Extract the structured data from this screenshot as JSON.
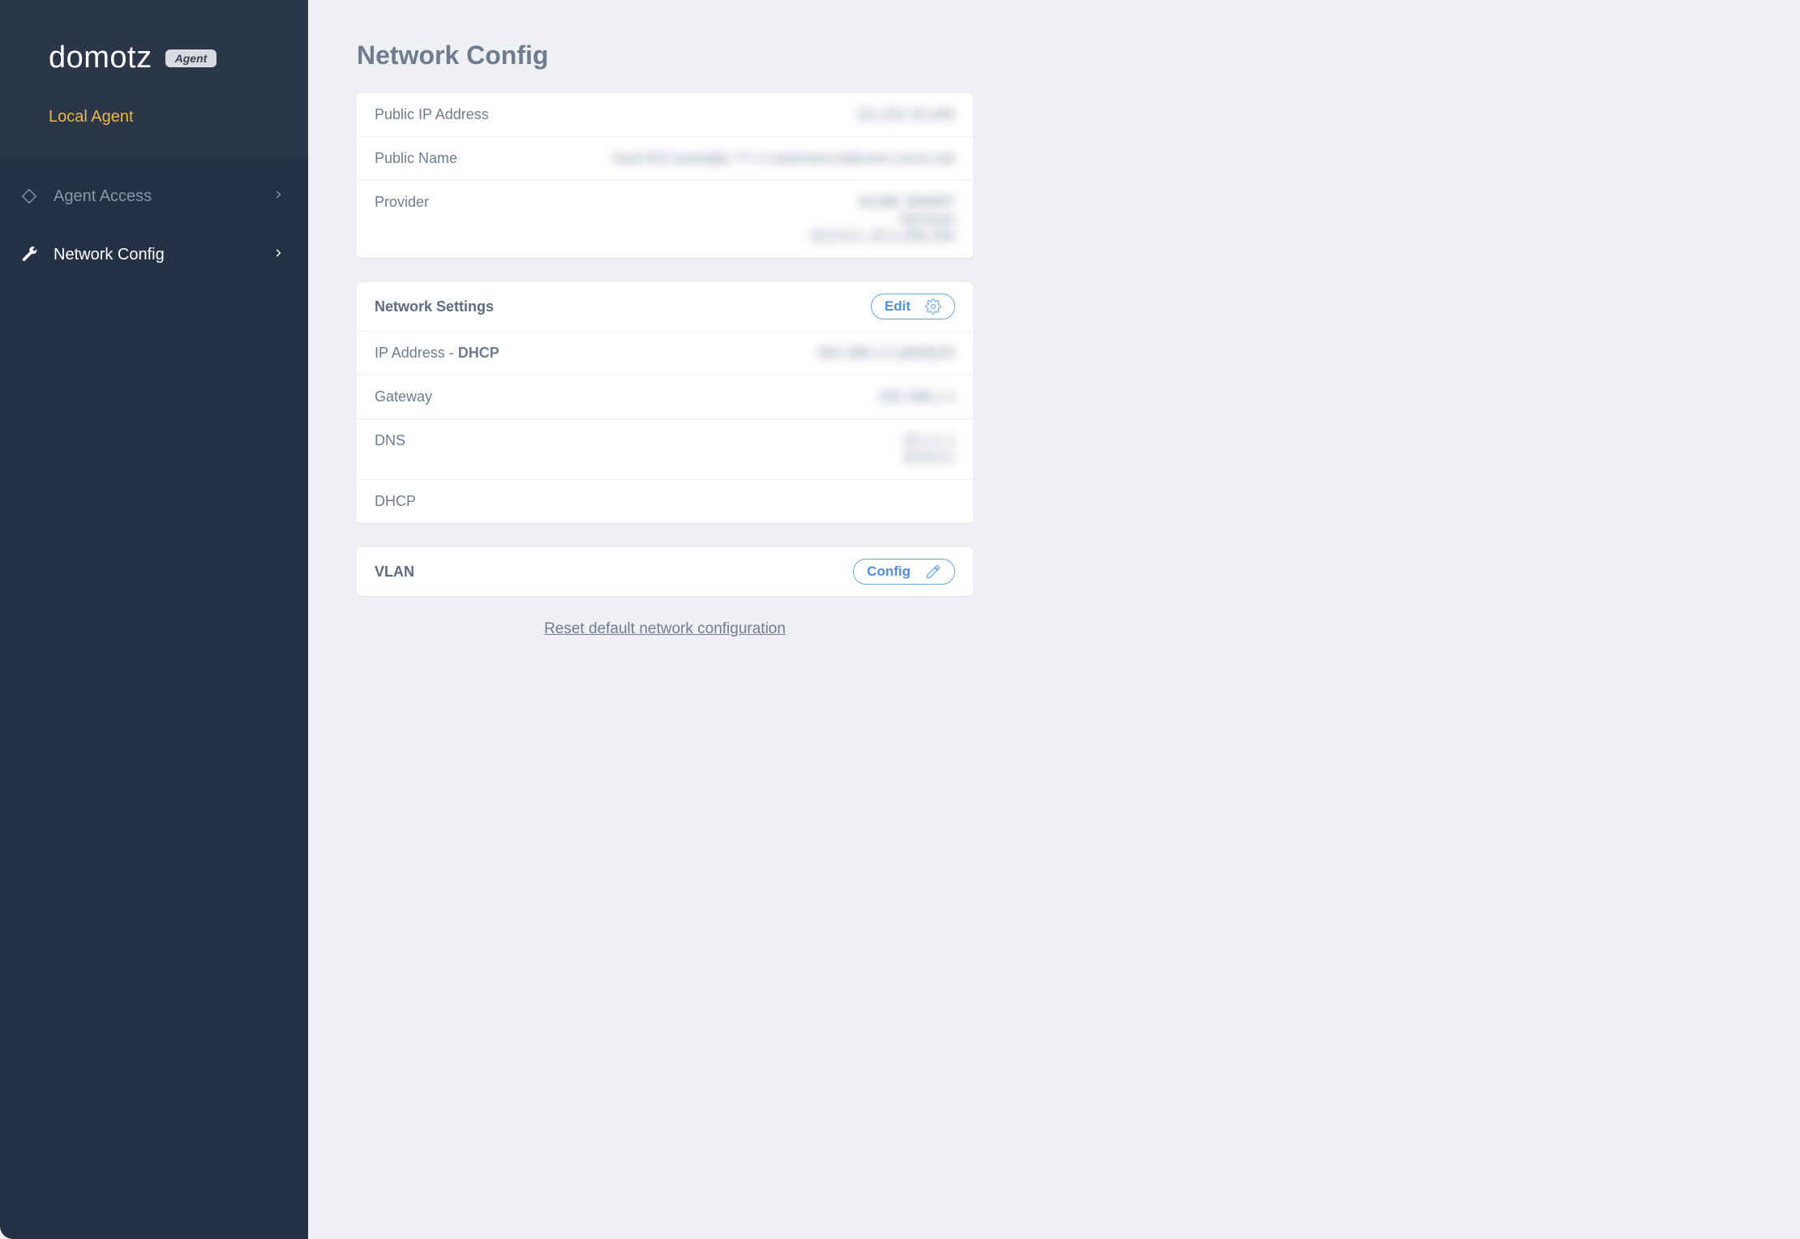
{
  "brand": {
    "name": "domotz",
    "badge": "Agent"
  },
  "sidebar": {
    "section_label": "Local Agent",
    "items": [
      {
        "label": "Agent Access",
        "active": false
      },
      {
        "label": "Network Config",
        "active": true
      }
    ]
  },
  "page": {
    "title": "Network Config"
  },
  "public_card": {
    "rows": [
      {
        "label": "Public IP Address",
        "value": "111.222.33.444"
      },
      {
        "label": "Public Name",
        "value": "host-012.example-77-1.customers.telecom-xxxxx.net"
      },
      {
        "label": "Provider",
        "value": "ACME SMART\nServices\n10.0.0.1–10.1.255.254"
      }
    ]
  },
  "network_settings": {
    "heading": "Network Settings",
    "edit_label": "Edit",
    "rows": [
      {
        "label_prefix": "IP Address - ",
        "label_strong": "DHCP",
        "value": "192.168.1.5 (eth0)/24"
      },
      {
        "label": "Gateway",
        "value": "192.168.1.1"
      },
      {
        "label": "DNS",
        "value": "10.1.1.1\n10.0.0.1"
      },
      {
        "label": "DHCP",
        "value": ""
      }
    ]
  },
  "vlan": {
    "heading": "VLAN",
    "config_label": "Config"
  },
  "reset_link": "Reset default network configuration"
}
